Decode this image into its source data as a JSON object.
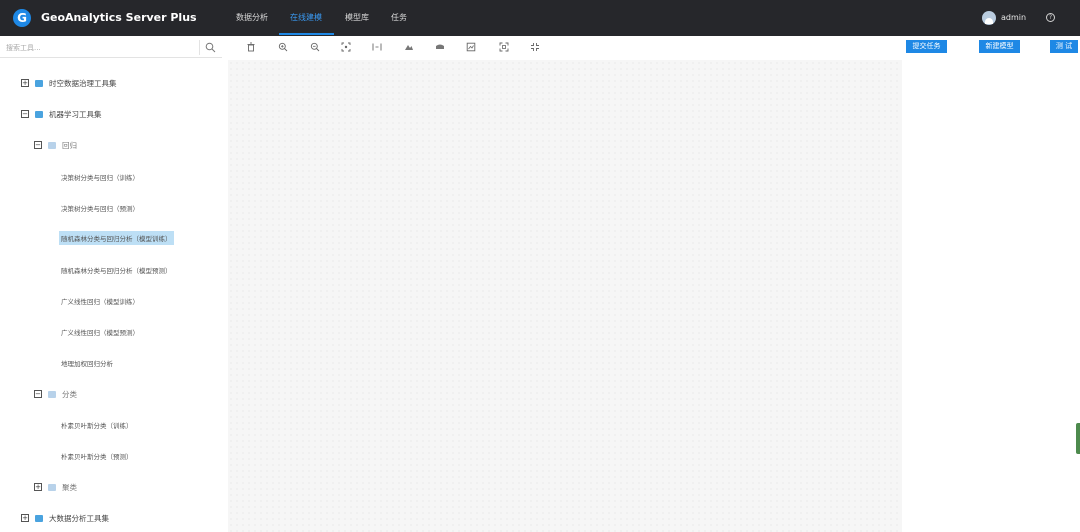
{
  "app": {
    "title": "GeoAnalytics Server Plus",
    "logo_letter": "G",
    "brand_color": "#1e88e5"
  },
  "nav": {
    "items": [
      {
        "label": "数据分析",
        "active": false
      },
      {
        "label": "在线建模",
        "active": true
      },
      {
        "label": "模型库",
        "active": false
      },
      {
        "label": "任务",
        "active": false
      }
    ]
  },
  "user": {
    "name": "admin",
    "avatar_icon": "user-avatar-icon",
    "help_icon": "question-circle-icon",
    "help_glyph": "?"
  },
  "search": {
    "placeholder": "搜索工具...",
    "icon": "search-icon"
  },
  "toolbar": {
    "icons": [
      "trash-icon",
      "zoom-in-icon",
      "zoom-out-icon",
      "fit-center-icon",
      "fit-width-icon",
      "layout-icon",
      "auto-layout-icon",
      "export-image-icon",
      "fullscreen-icon",
      "shrink-icon"
    ]
  },
  "actions": {
    "submit_label": "提交任务",
    "new_model_label": "新建模型",
    "test_label": "测 试"
  },
  "tree": {
    "groups": [
      {
        "label": "时空数据治理工具集",
        "toggle": "+"
      },
      {
        "label": "机器学习工具集",
        "toggle": "−"
      },
      {
        "label": "大数据分析工具集",
        "toggle": "+"
      }
    ],
    "subgroups": [
      {
        "label": "回归",
        "toggle": "−"
      },
      {
        "label": "分类",
        "toggle": "−"
      },
      {
        "label": "聚类",
        "toggle": "+"
      }
    ],
    "regression_tools": [
      "决策树分类与回归（训练）",
      "决策树分类与回归（预测）",
      "随机森林分类与回归分析（模型训练）",
      "随机森林分类与回归分析（模型预测）",
      "广义线性回归（模型训练）",
      "广义线性回归（模型预测）",
      "地理加权回归分析"
    ],
    "classification_tools": [
      "朴素贝叶斯分类（训练）",
      "朴素贝叶斯分类（预测）"
    ],
    "selected_tool": "随机森林分类与回归分析（模型训练）"
  }
}
